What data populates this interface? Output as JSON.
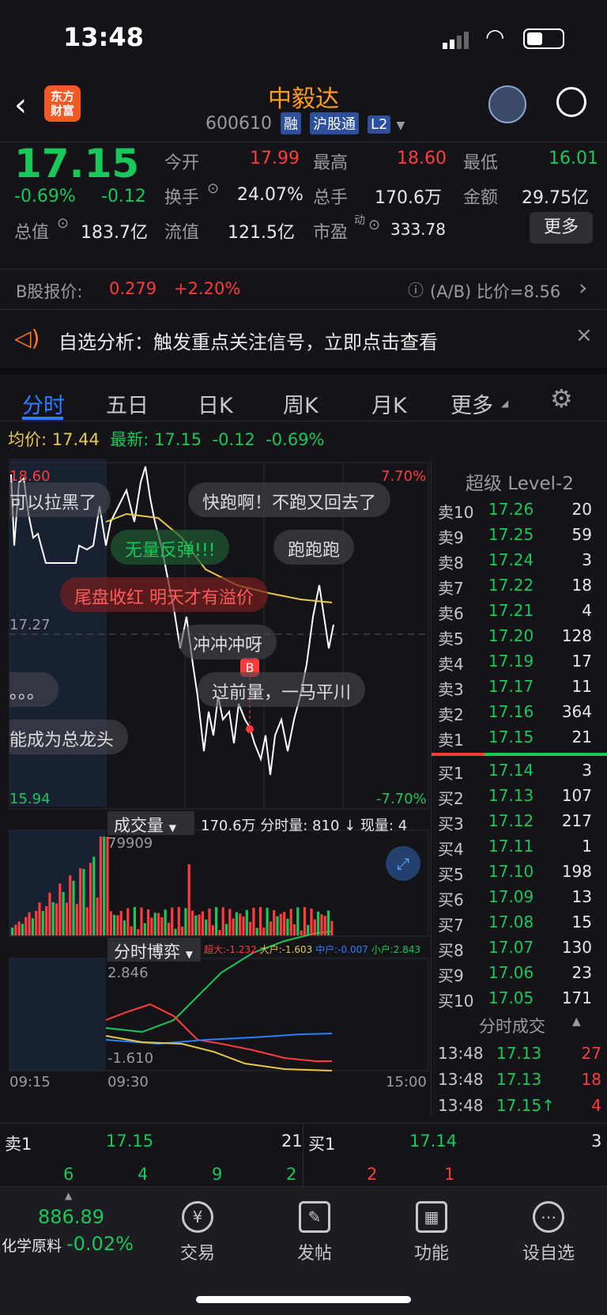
{
  "status_time": "13:48",
  "header": {
    "title": "中毅达",
    "code": "600610",
    "tags": [
      "融",
      "沪股通",
      "L2"
    ],
    "logo": "东方\n财富"
  },
  "quote": {
    "price": "17.15",
    "pct": "-0.69%",
    "chg": "-0.12",
    "open_label": "今开",
    "open": "17.99",
    "high_label": "最高",
    "high": "18.60",
    "low_label": "最低",
    "low": "16.01",
    "turnover_label": "换手",
    "turnover": "24.07%",
    "vol_label": "总手",
    "vol": "170.6万",
    "amt_label": "金额",
    "amt": "29.75亿",
    "mcap_label": "总值",
    "mcap": "183.7亿",
    "float_label": "流值",
    "float": "121.5亿",
    "pe_label": "市盈",
    "pe_sup": "动",
    "pe": "333.78",
    "more": "更多"
  },
  "bshare": {
    "label": "B股报价:",
    "price": "0.279",
    "pct": "+2.20%",
    "ratio": "(A/B) 比价=8.56"
  },
  "banner": "自选分析：触发重点关注信号，立即点击查看",
  "tabs": [
    "分时",
    "五日",
    "日K",
    "周K",
    "月K",
    "更多"
  ],
  "info": {
    "avg_label": "均价:",
    "avg": "17.44",
    "latest_label": "最新:",
    "latest": "17.15",
    "chg": "-0.12",
    "pct": "-0.69%"
  },
  "chart": {
    "ymax": "18.60",
    "ymid": "17.27",
    "ymin": "15.94",
    "pmax": "7.70%",
    "pmin": "-7.70%",
    "vol_label": "成交量",
    "vol_info": "170.6万 分时量: 810 ↓ 现量: 4",
    "vol_max": "79909",
    "game_label": "分时博弈",
    "game_cd": "超大:-1.232",
    "game_dh": "大户:-1.603",
    "game_zh": "中户:-0.007",
    "game_xh": "小户:2.843",
    "game_max": "2.846",
    "game_min": "-1.610",
    "t0": "09:15",
    "t1": "09:30",
    "t2": "15:00",
    "bubbles": [
      "可以拉黑了",
      "快跑啊！不跑又回去了",
      "无量反弹!!!",
      "跑跑跑",
      "尾盘收红 明天才有溢价",
      "冲冲冲呀",
      "过前量，一马平川",
      "。。。",
      "能成为总龙头"
    ],
    "marker": "B"
  },
  "orderbook": {
    "title": "超级 Level-2",
    "asks": [
      [
        "卖10",
        "17.26",
        "20"
      ],
      [
        "卖9",
        "17.25",
        "59"
      ],
      [
        "卖8",
        "17.24",
        "3"
      ],
      [
        "卖7",
        "17.22",
        "18"
      ],
      [
        "卖6",
        "17.21",
        "4"
      ],
      [
        "卖5",
        "17.20",
        "128"
      ],
      [
        "卖4",
        "17.19",
        "17"
      ],
      [
        "卖3",
        "17.17",
        "11"
      ],
      [
        "卖2",
        "17.16",
        "364"
      ],
      [
        "卖1",
        "17.15",
        "21"
      ]
    ],
    "bids": [
      [
        "买1",
        "17.14",
        "3"
      ],
      [
        "买2",
        "17.13",
        "107"
      ],
      [
        "买3",
        "17.12",
        "217"
      ],
      [
        "买4",
        "17.11",
        "1"
      ],
      [
        "买5",
        "17.10",
        "198"
      ],
      [
        "买6",
        "17.09",
        "13"
      ],
      [
        "买7",
        "17.08",
        "15"
      ],
      [
        "买8",
        "17.07",
        "130"
      ],
      [
        "买9",
        "17.06",
        "23"
      ],
      [
        "买10",
        "17.05",
        "171"
      ]
    ],
    "ticks_title": "分时成交",
    "ticks": [
      [
        "13:48",
        "17.13",
        "27"
      ],
      [
        "13:48",
        "17.13",
        "18"
      ],
      [
        "13:48",
        "17.15↑",
        "4"
      ]
    ]
  },
  "bottom": {
    "sell_label": "卖1",
    "sell_price": "17.15",
    "sell_qty": "21",
    "buy_label": "买1",
    "buy_price": "17.14",
    "buy_qty": "3",
    "sell_nums": [
      "6",
      "4",
      "9",
      "2"
    ],
    "buy_nums": [
      "2",
      "1"
    ]
  },
  "nav": {
    "index": "886.89",
    "sector": "化学原料",
    "sector_pct": "-0.02%",
    "items": [
      "交易",
      "发帖",
      "功能",
      "设自选"
    ],
    "icons": [
      "trade-icon",
      "post-icon",
      "function-icon",
      "watchlist-icon"
    ]
  },
  "colors": {
    "up": "#ff3b3b",
    "down": "#19c85a",
    "accent": "#2a7fff"
  }
}
